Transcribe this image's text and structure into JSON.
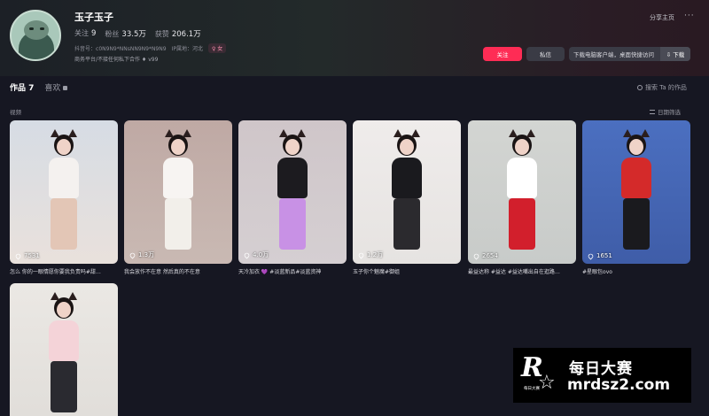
{
  "profile": {
    "name": "玉子玉子",
    "stats": [
      {
        "label": "关注",
        "value": "9"
      },
      {
        "label": "粉丝",
        "value": "33.5万"
      },
      {
        "label": "获赞",
        "value": "206.1万"
      }
    ],
    "account_id_label": "抖音号：",
    "account_id": "c0N9N9*NNsNN9N9*N9N9",
    "ip_location": "IP属地：河北",
    "gender_badge": "♀ 女",
    "bio": "商务平台/不接任何私下合作 ♦ v99"
  },
  "header_actions": {
    "share": "分享主页",
    "more": "···",
    "follow": "关注",
    "message": "私信",
    "download_hint": "下载电脑客户端，桌面快捷访问",
    "download": "⇩ 下载"
  },
  "tabs": [
    {
      "label": "作品 7",
      "active": true
    },
    {
      "label": "喜欢",
      "active": false
    }
  ],
  "search_placeholder": "搜索 Ta 的作品",
  "section_label": "视频",
  "sort_label": "日期筛选",
  "videos": [
    {
      "likes": "7531",
      "caption": "怎么 你的一眼情愿你要我负责吗#甜…",
      "cover_bg": "#e9e1dc",
      "outfit": "#f4f1ef",
      "legs": "#e3c6b6",
      "wall": "#d6dce4"
    },
    {
      "likes": "1.3万",
      "caption": "我会放作不在意 然后真的不在意",
      "cover_bg": "#c9b9b3",
      "outfit": "#f7f4f2",
      "legs": "#f2efea",
      "wall": "#bfa9a4"
    },
    {
      "likes": "4.0万",
      "caption": "天冷加衣 💜 #淡蓝新品#淡蓝资神",
      "cover_bg": "#d5cfd2",
      "outfit": "#1c1b1f",
      "legs": "#c891e5",
      "wall": "#cfc6c9"
    },
    {
      "likes": "1.2万",
      "caption": "玉子你个魅魔#御姐",
      "cover_bg": "#e6e3e1",
      "outfit": "#1a1a1e",
      "legs": "#2b2a2e",
      "wall": "#efeceb"
    },
    {
      "likes": "2654",
      "caption": "最益达称 #益达 #益达嘴出自在逛路…",
      "cover_bg": "#c8cbc9",
      "outfit": "#ffffff",
      "legs": "#d21f2c",
      "wall": "#d3d5d2"
    },
    {
      "likes": "1651",
      "caption": "#星眼包ovo",
      "cover_bg": "#3f5da8",
      "outfit": "#d42a2a",
      "legs": "#1a1a1e",
      "wall": "#4b6fc0"
    },
    {
      "likes": "",
      "caption": "",
      "cover_bg": "#e0ddd9",
      "outfit": "#f4d3d8",
      "legs": "#2a2a30",
      "wall": "#ebe8e4"
    }
  ],
  "watermark": {
    "letter": "R",
    "sub": "每日大赛",
    "title": "每日大赛",
    "url": "mrdsz2.com"
  }
}
